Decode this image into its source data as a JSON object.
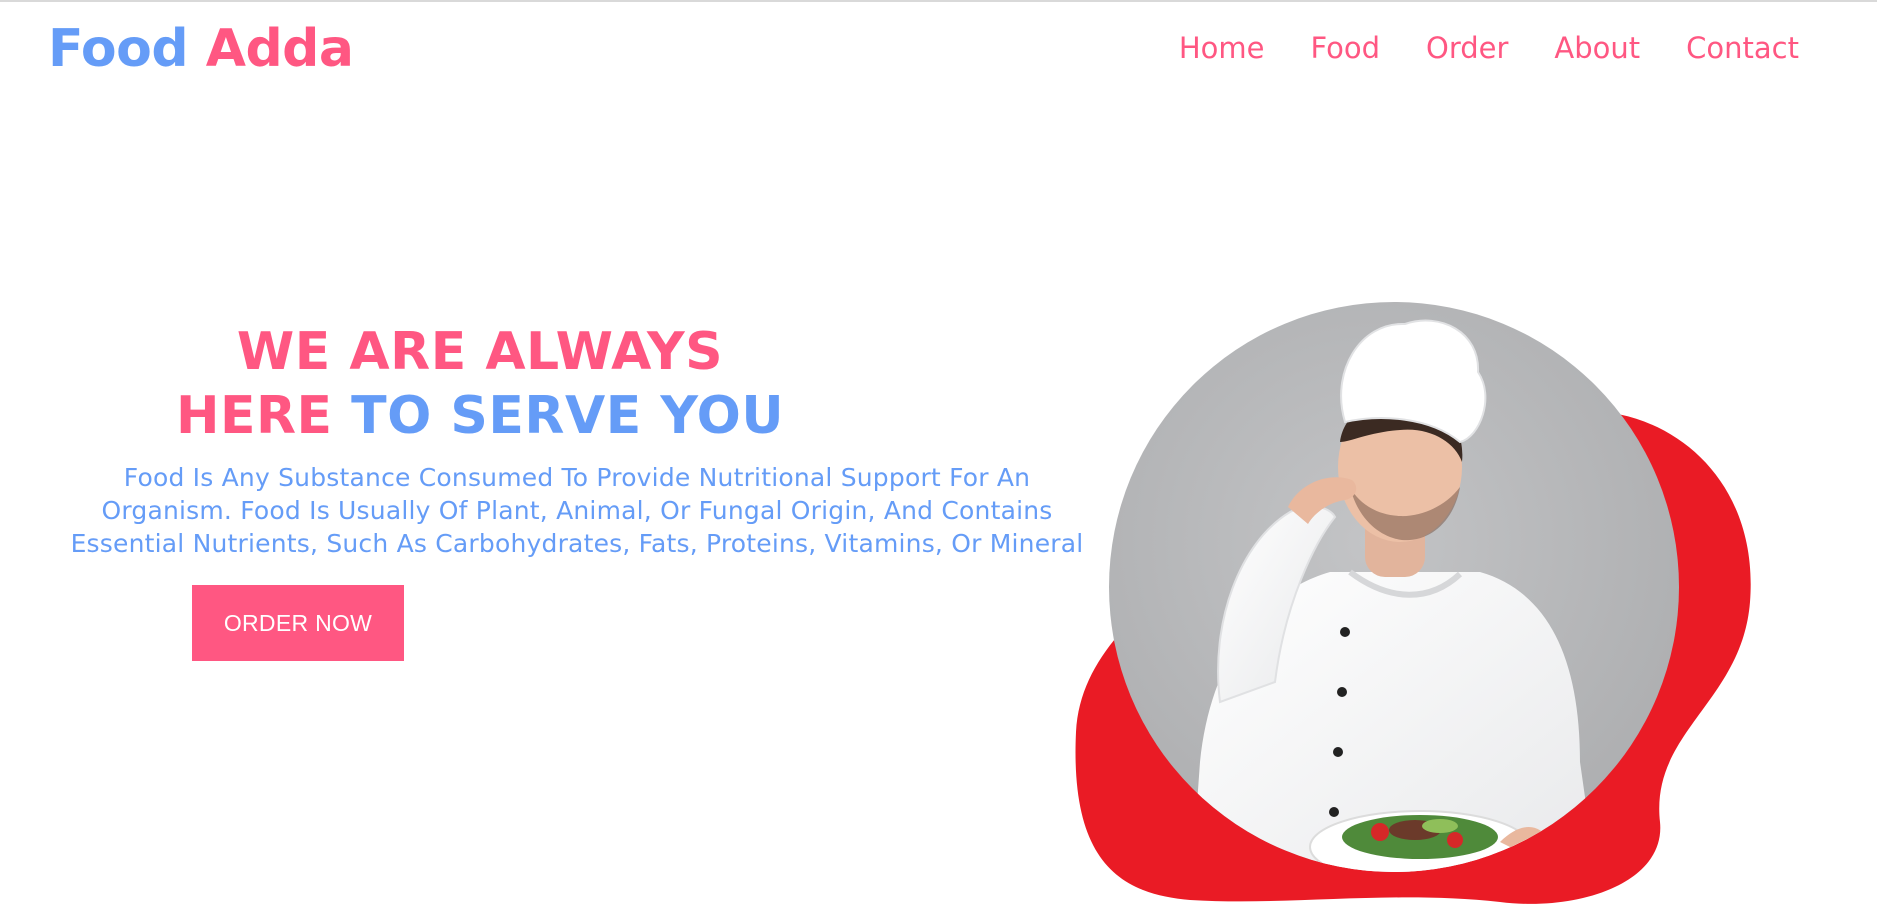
{
  "brand": {
    "word1": "Food",
    "word2": "Adda"
  },
  "nav": {
    "items": [
      {
        "label": "Home"
      },
      {
        "label": "Food"
      },
      {
        "label": "Order"
      },
      {
        "label": "About"
      },
      {
        "label": "Contact"
      }
    ]
  },
  "hero": {
    "title_line1": "WE ARE ALWAYS",
    "title_line2_pink": "HERE",
    "title_line2_blue": "TO SERVE YOU",
    "description": "Food Is Any Substance Consumed To Provide Nutritional Support For An\nOrganism. Food Is Usually Of Plant, Animal, Or Fungal Origin, And Contains\nEssential Nutrients, Such As Carbohydrates, Fats, Proteins, Vitamins, Or Mineral",
    "cta_label": "ORDER NOW",
    "image_subject": "chef-kissing-fingers-with-salad-plate"
  },
  "colors": {
    "blue": "#659cf7",
    "pink": "#ff5782",
    "blob_red": "#ea1b25",
    "photo_bg": "#b5b6b8"
  }
}
